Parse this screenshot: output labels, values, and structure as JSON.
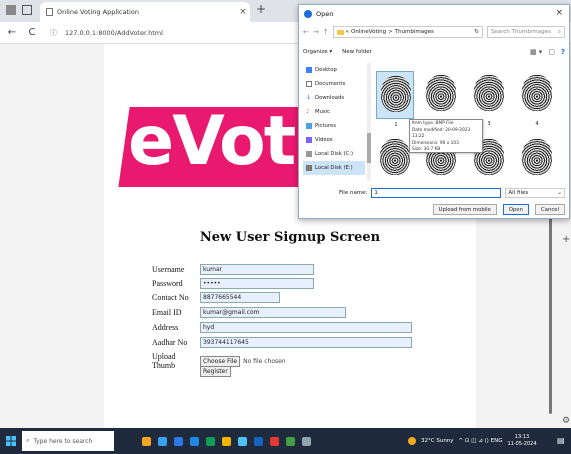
{
  "browser": {
    "tab_title": "Online Voting Application",
    "tab_close": "×",
    "new_tab": "+",
    "back": "←",
    "reload": "C",
    "info": "ⓘ",
    "url": "127.0.0.1:8000/AddVoter.html"
  },
  "page": {
    "logo_text": "eVot",
    "heading": "New User Signup Screen",
    "form": {
      "username_label": "Username",
      "username_value": "kumar",
      "password_label": "Password",
      "password_value": "•••••",
      "contact_label": "Contact No",
      "contact_value": "8877665544",
      "email_label": "Email ID",
      "email_value": "kumar@gmail.com",
      "address_label": "Address",
      "address_value": "hyd",
      "aadhar_label": "Aadhar No",
      "aadhar_value": "393744117645",
      "thumb_label": "Upload Thumb",
      "choose_file": "Choose File",
      "no_file": "No file chosen",
      "register": "Register"
    },
    "side_plus": "+",
    "side_gear": "⚙"
  },
  "dialog": {
    "title": "Open",
    "close": "×",
    "path_prefix": "«",
    "path_part1": "OnlineVoting",
    "path_sep": ">",
    "path_part2": "Thumbimages",
    "refresh": "↻",
    "search_placeholder": "Search Thumbimages",
    "search_icon": "⌕",
    "organize": "Organize ▾",
    "new_folder": "New folder",
    "view_icon": "▦ ▾",
    "pane_icon": "▢",
    "help_icon": "?",
    "nav": [
      {
        "label": "Desktop"
      },
      {
        "label": "Documents"
      },
      {
        "label": "Downloads"
      },
      {
        "label": "Music"
      },
      {
        "label": "Pictures"
      },
      {
        "label": "Videos"
      },
      {
        "label": "Local Disk (C:)"
      },
      {
        "label": "Local Disk (E:)"
      }
    ],
    "files": [
      "1",
      "2",
      "3",
      "4"
    ],
    "tooltip": {
      "line1": "Item type: BMP File",
      "line2": "Date modified: 20-09-2023 13:22",
      "line3": "Dimensions: 96 x 103",
      "line4": "Size: 30.7 KB"
    },
    "filename_label": "File name:",
    "filename_value": "1",
    "filter": "All files",
    "upload_mobile": "Upload from mobile",
    "open": "Open",
    "cancel": "Cancel"
  },
  "taskbar": {
    "search_placeholder": "Type here to search",
    "weather": "32°C Sunny",
    "tray_text": "^ ⊡ ◫ ⊿ ⟨⟩ ENG",
    "time": "13:13",
    "date": "11-05-2024",
    "notification": "▤"
  },
  "colors": {
    "logo": "#e8196e",
    "accent": "#1a6ed8",
    "taskbar": "#1f2b3d"
  }
}
